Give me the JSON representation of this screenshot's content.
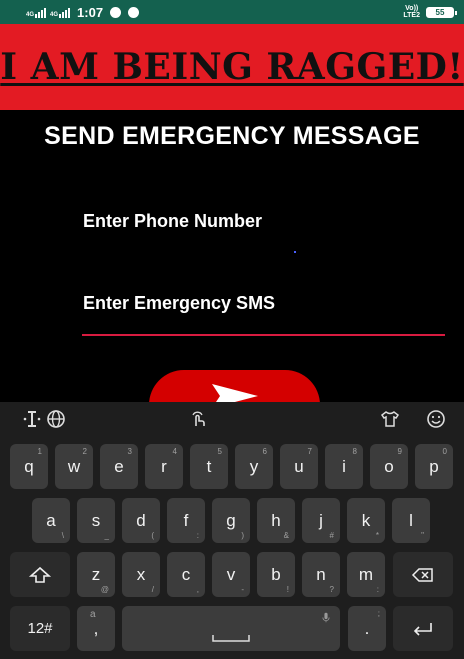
{
  "status_bar": {
    "network_1": "4G",
    "network_2": "4G",
    "time": "1:07",
    "volte": "Vo))",
    "volte_2": "LTE2",
    "battery": "55"
  },
  "banner": {
    "title": "I AM BEING RAGGED!",
    "background": "#e31b23"
  },
  "heading": "SEND EMERGENCY MESSAGE",
  "form": {
    "phone_label": "Enter Phone Number",
    "sms_label": "Enter Emergency SMS",
    "underline_color": "#d81b40"
  },
  "send_button": {
    "icon": "send-arrow-icon",
    "color": "#d40000"
  },
  "keyboard": {
    "row1": [
      {
        "key": "q",
        "hint": "1"
      },
      {
        "key": "w",
        "hint": "2"
      },
      {
        "key": "e",
        "hint": "3"
      },
      {
        "key": "r",
        "hint": "4"
      },
      {
        "key": "t",
        "hint": "5"
      },
      {
        "key": "y",
        "hint": "6"
      },
      {
        "key": "u",
        "hint": "7"
      },
      {
        "key": "i",
        "hint": "8"
      },
      {
        "key": "o",
        "hint": "9"
      },
      {
        "key": "p",
        "hint": "0"
      }
    ],
    "row2": [
      {
        "key": "a",
        "hint": "@"
      },
      {
        "key": "s",
        "hint": "#"
      },
      {
        "key": "d",
        "hint": "$"
      },
      {
        "key": "f",
        "hint": "_"
      },
      {
        "key": "g",
        "hint": "&"
      },
      {
        "key": "h",
        "hint": "-"
      },
      {
        "key": "j",
        "hint": "+"
      },
      {
        "key": "k",
        "hint": "("
      },
      {
        "key": "l",
        "hint": ")"
      }
    ],
    "row2_bottom_hints": [
      "\\",
      "_",
      "(",
      ":",
      ")",
      "&",
      "#",
      "*",
      "\""
    ],
    "row3": [
      {
        "key": "z",
        "hint": "@"
      },
      {
        "key": "x",
        "hint": "/"
      },
      {
        "key": "c",
        "hint": ","
      },
      {
        "key": "v",
        "hint": "-"
      },
      {
        "key": "b",
        "hint": "!"
      },
      {
        "key": "n",
        "hint": "?"
      },
      {
        "key": "m",
        "hint": ":"
      }
    ],
    "symbols_key": "12#",
    "comma_key": ",",
    "comma_hint": "a",
    "period_key": ".",
    "period_hint": ";"
  }
}
